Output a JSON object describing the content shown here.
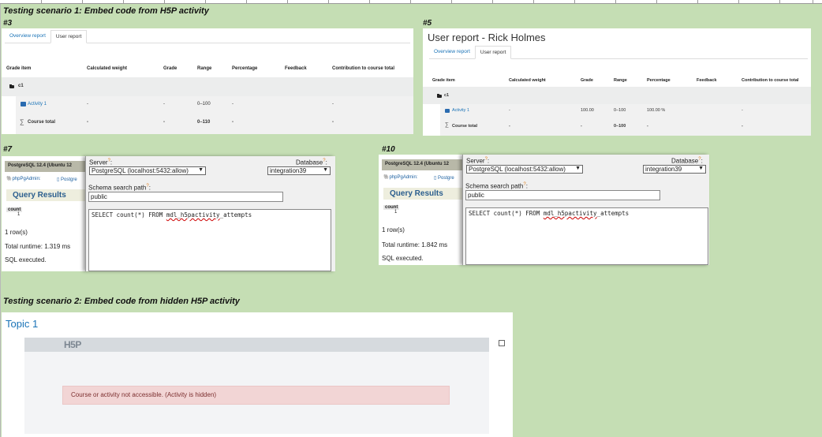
{
  "scenario1": {
    "title": "Testing scenario 1: Embed code from H5P activity"
  },
  "scenario2": {
    "title": "Testing scenario 2: Embed code from hidden H5P activity"
  },
  "captions": {
    "c3": "#3",
    "c5": "#5",
    "c7": "#7",
    "c10": "#10"
  },
  "grade_tabs": {
    "overview": "Overview report",
    "user": "User report"
  },
  "grade_columns": [
    "Grade item",
    "Calculated weight",
    "Grade",
    "Range",
    "Percentage",
    "Feedback",
    "Contribution to course total"
  ],
  "report3": {
    "category": "c1",
    "activity": {
      "name": "Activity 1",
      "weight": "-",
      "grade": "-",
      "range": "0–100",
      "percentage": "-",
      "contribution": "-"
    },
    "total": {
      "name": "Course total",
      "weight": "-",
      "grade": "-",
      "range": "0–110",
      "percentage": "-",
      "contribution": "-"
    }
  },
  "report5": {
    "title": "User report - Rick Holmes",
    "category": "c1",
    "activity": {
      "name": "Activity 1",
      "weight": "-",
      "grade": "100.00",
      "range": "0–100",
      "percentage": "100.00 %",
      "contribution": "-"
    },
    "total": {
      "name": "Course total",
      "weight": "-",
      "grade": "-",
      "range": "0–100",
      "percentage": "-",
      "contribution": "-"
    }
  },
  "pg7": {
    "server_header": "PostgreSQL 12.4 (Ubuntu 12",
    "phppgadmin": "phpPgAdmin:",
    "postgres_link": "Postgre",
    "query_results": "Query Results",
    "count_header": "count",
    "count_value": "1",
    "rows": "1 row(s)",
    "runtime": "Total runtime: 1.319 ms",
    "executed": "SQL executed.",
    "server_label": "Server",
    "server_value": "PostgreSQL (localhost:5432:allow)",
    "database_label": "Database",
    "database_value": "integration39",
    "schema_label": "Schema search path",
    "schema_value": "public",
    "sql_prefix": "SELECT count(*) FROM ",
    "sql_table": "mdl_h5pactivity",
    "sql_suffix": "_attempts"
  },
  "pg10": {
    "server_header": "PostgreSQL 12.4 (Ubuntu 12",
    "phppgadmin": "phpPgAdmin:",
    "postgres_link": "Postgre",
    "query_results": "Query Results",
    "count_header": "count",
    "count_value": "1",
    "rows": "1 row(s)",
    "runtime": "Total runtime: 1.842 ms",
    "executed": "SQL executed.",
    "server_label": "Server",
    "server_value": "PostgreSQL (localhost:5432:allow)",
    "database_label": "Database",
    "database_value": "integration39",
    "schema_label": "Schema search path",
    "schema_value": "public",
    "sql_prefix": "SELECT count(*) FROM ",
    "sql_table": "mdl_h5pactivity",
    "sql_suffix": "_attempts"
  },
  "topic": {
    "title": "Topic 1",
    "h5p_logo": "H5P",
    "alert": "Course or activity not accessible. (Activity is hidden)"
  },
  "colors": {
    "background": "#c5deb4",
    "link": "#1a73b7",
    "alert_bg": "#f2d5d5"
  }
}
